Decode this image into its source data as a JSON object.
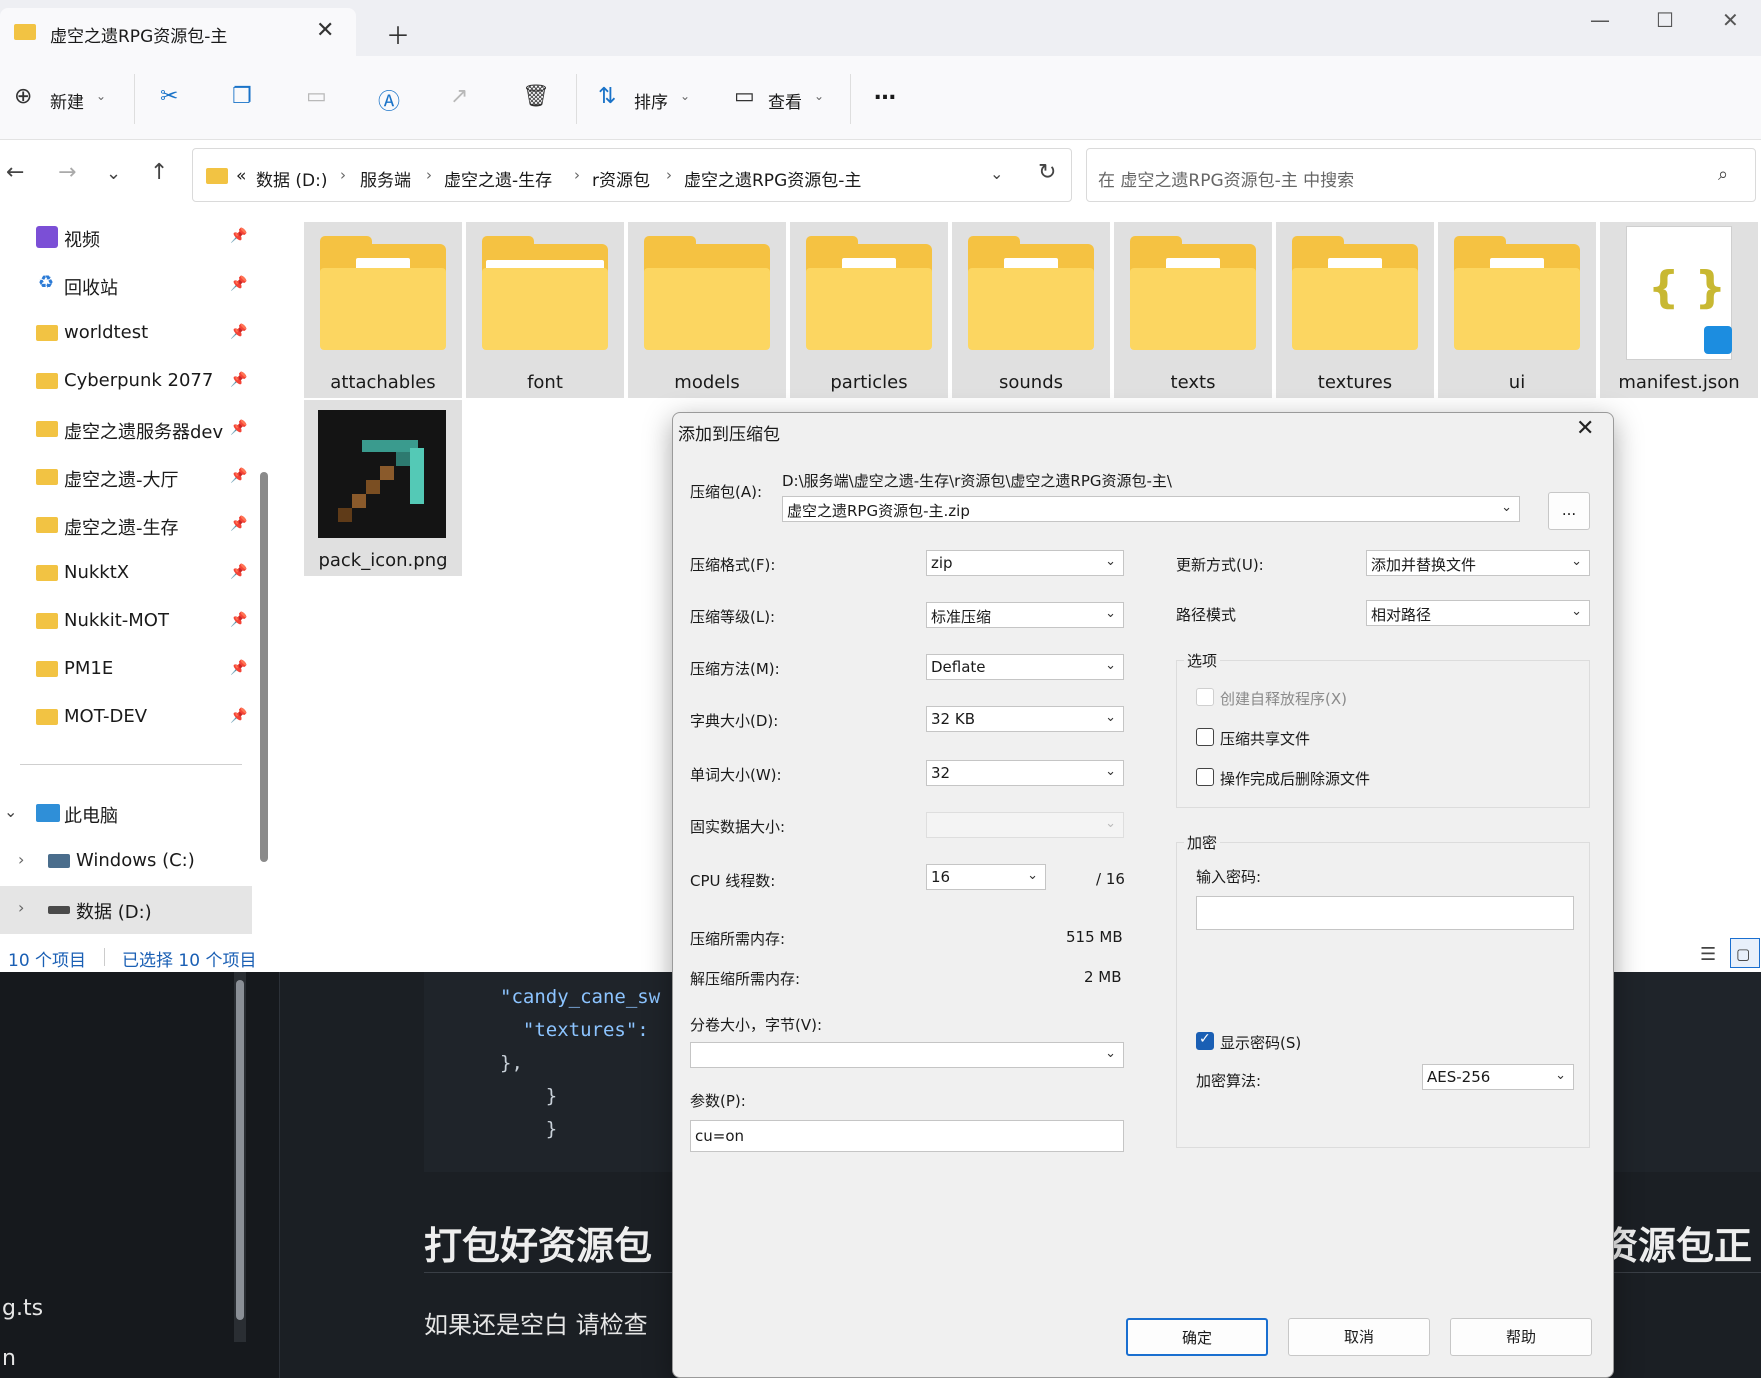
{
  "explorer": {
    "tab_title": "虚空之遗RPG资源包-主",
    "toolbar": {
      "new": "新建",
      "sort": "排序",
      "view": "查看",
      "more": "…"
    },
    "breadcrumb": [
      "数据 (D:)",
      "服务端",
      "虚空之遗-生存",
      "r资源包",
      "虚空之遗RPG资源包-主"
    ],
    "breadcrumb_overflow": "«",
    "search_placeholder": "在 虚空之遗RPG资源包-主 中搜索",
    "nav_items": [
      "视频",
      "回收站",
      "worldtest",
      "Cyberpunk 2077",
      "虚空之遗服务器dev",
      "虚空之遗-大厅",
      "虚空之遗-生存",
      "NukktX",
      "Nukkit-MOT",
      "PM1E",
      "MOT-DEV"
    ],
    "this_pc": "此电脑",
    "drives": [
      "Windows (C:)",
      "数据 (D:)"
    ],
    "files": [
      "attachables",
      "font",
      "models",
      "particles",
      "sounds",
      "texts",
      "textures",
      "ui",
      "manifest.json",
      "pack_icon.png"
    ],
    "status": {
      "count": "10 个项目",
      "selected": "已选择 10 个项目"
    }
  },
  "background": {
    "code_lines": [
      "\"candy_cane_sw",
      "  \"textures\":",
      "},",
      "    }",
      "    }"
    ],
    "heading": "打包好资源包",
    "heading_right": "资源包正",
    "paragraph": "如果还是空白 请检查",
    "sidebar_lines": [
      "g.ts",
      "n"
    ]
  },
  "dialog": {
    "title": "添加到压缩包",
    "archive_label": "压缩包(A):",
    "archive_path": "D:\\服务端\\虚空之遗-生存\\r资源包\\虚空之遗RPG资源包-主\\",
    "archive_name": "虚空之遗RPG资源包-主.zip",
    "browse_label": "...",
    "format_label": "压缩格式(F):",
    "format_value": "zip",
    "level_label": "压缩等级(L):",
    "level_value": "标准压缩",
    "method_label": "压缩方法(M):",
    "method_value": "Deflate",
    "dict_label": "字典大小(D):",
    "dict_value": "32 KB",
    "word_label": "单词大小(W):",
    "word_value": "32",
    "solid_label": "固实数据大小:",
    "cpu_label": "CPU 线程数:",
    "cpu_value": "16",
    "cpu_total": "/ 16",
    "mem_compress_label": "压缩所需内存:",
    "mem_compress_value": "515 MB",
    "mem_decompress_label": "解压缩所需内存:",
    "mem_decompress_value": "2 MB",
    "split_label": "分卷大小，字节(V):",
    "params_label": "参数(P):",
    "params_value": "cu=on",
    "update_label": "更新方式(U):",
    "update_value": "添加并替换文件",
    "path_label": "路径模式",
    "path_value": "相对路径",
    "options_title": "选项",
    "opt_sfx": "创建自释放程序(X)",
    "opt_shared": "压缩共享文件",
    "opt_delete": "操作完成后删除源文件",
    "encrypt_title": "加密",
    "password_label": "输入密码:",
    "show_password": "显示密码(S)",
    "algo_label": "加密算法:",
    "algo_value": "AES-256",
    "ok": "确定",
    "cancel": "取消",
    "help": "帮助"
  }
}
